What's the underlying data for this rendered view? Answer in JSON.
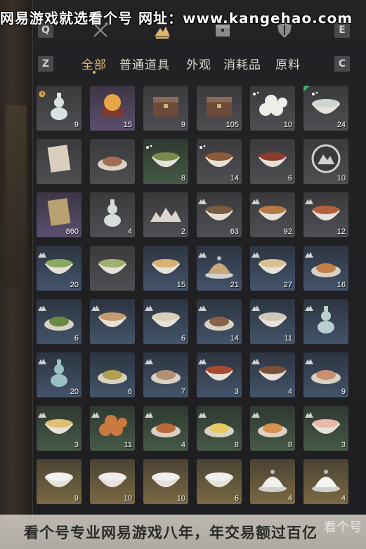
{
  "watermark": {
    "top": "网易游戏就选看个号  网址：www.kangehao.com",
    "bottom": "看个号专业网易游戏八年，年交易额过百亿",
    "logo": "看个号"
  },
  "keys": {
    "q": "Q",
    "e": "E",
    "z": "Z",
    "c": "C"
  },
  "categories": [
    {
      "name": "swords-icon"
    },
    {
      "name": "mountain-icon",
      "active": true
    },
    {
      "name": "chest-icon"
    },
    {
      "name": "shield-icon"
    }
  ],
  "tabs": [
    {
      "label": "全部",
      "active": true
    },
    {
      "label": "普通道具"
    },
    {
      "label": "外观"
    },
    {
      "label": "消耗品"
    },
    {
      "label": "原料"
    }
  ],
  "colors": {
    "accent": "#e0b56a",
    "qty": "#ffffff"
  },
  "items": [
    {
      "icon": "gourd-vase",
      "qty": "9",
      "rarity": "gray",
      "badge": "clock"
    },
    {
      "icon": "golden-orb",
      "qty": "15",
      "rarity": "purple"
    },
    {
      "icon": "wooden-chest",
      "qty": "9",
      "rarity": "gray"
    },
    {
      "icon": "wooden-chest",
      "qty": "105",
      "rarity": "gray"
    },
    {
      "icon": "steamed-buns",
      "qty": "10",
      "rarity": "gray",
      "badge": "sparkle"
    },
    {
      "icon": "porridge-bowl",
      "qty": "24",
      "rarity": "gray",
      "badge": "tag-sparkle"
    },
    {
      "icon": "letter-scroll",
      "qty": "",
      "rarity": "gray"
    },
    {
      "icon": "meat-slice",
      "qty": "",
      "rarity": "gray"
    },
    {
      "icon": "veggie-dish",
      "qty": "8",
      "rarity": "green",
      "badge": "sparkle"
    },
    {
      "icon": "stew-pot",
      "qty": "14",
      "rarity": "gray",
      "badge": "sparkle"
    },
    {
      "icon": "red-stew",
      "qty": "6",
      "rarity": "gray"
    },
    {
      "icon": "mountain-token",
      "qty": "10",
      "rarity": "gray"
    },
    {
      "icon": "talisman",
      "qty": "860",
      "rarity": "purple"
    },
    {
      "icon": "flower-vase",
      "qty": "4",
      "rarity": "gray"
    },
    {
      "icon": "snow-mountains",
      "qty": "2",
      "rarity": "gray"
    },
    {
      "icon": "meat-stew",
      "qty": "63",
      "rarity": "gray",
      "badge": "mountain"
    },
    {
      "icon": "fried-dish",
      "qty": "92",
      "rarity": "gray",
      "badge": "mountain"
    },
    {
      "icon": "soup-pot",
      "qty": "12",
      "rarity": "gray",
      "badge": "mountain"
    },
    {
      "icon": "green-soup",
      "qty": "20",
      "rarity": "blue",
      "badge": "mountain"
    },
    {
      "icon": "green-noodle",
      "qty": "",
      "rarity": "gray"
    },
    {
      "icon": "egg-soup",
      "qty": "15",
      "rarity": "blue"
    },
    {
      "icon": "bun-steamer",
      "qty": "21",
      "rarity": "blue",
      "badge": "mountain"
    },
    {
      "icon": "noodle-bowl",
      "qty": "27",
      "rarity": "blue",
      "badge": "mountain"
    },
    {
      "icon": "noodle-plate",
      "qty": "16",
      "rarity": "blue",
      "badge": "mountain"
    },
    {
      "icon": "greens-plate",
      "qty": "6",
      "rarity": "blue",
      "badge": "mountain"
    },
    {
      "icon": "soup-bowl",
      "qty": "",
      "rarity": "blue",
      "badge": "mountain"
    },
    {
      "icon": "tofu-soup",
      "qty": "6",
      "rarity": "blue",
      "badge": "mountain"
    },
    {
      "icon": "meat-plate",
      "qty": "14",
      "rarity": "blue",
      "badge": "mountain"
    },
    {
      "icon": "rice-bowl",
      "qty": "11",
      "rarity": "blue",
      "badge": "mountain"
    },
    {
      "icon": "wine-vase",
      "qty": "",
      "rarity": "blue",
      "badge": "mountain"
    },
    {
      "icon": "blue-vase",
      "qty": "20",
      "rarity": "blue",
      "badge": "mountain"
    },
    {
      "icon": "grain-plate",
      "qty": "6",
      "rarity": "blue"
    },
    {
      "icon": "dumpling-plate",
      "qty": "7",
      "rarity": "blue",
      "badge": "mountain"
    },
    {
      "icon": "chili-bowl",
      "qty": "3",
      "rarity": "blue",
      "badge": "mountain"
    },
    {
      "icon": "clay-pot",
      "qty": "4",
      "rarity": "blue",
      "badge": "mountain"
    },
    {
      "icon": "pork-slices",
      "qty": "9",
      "rarity": "blue",
      "badge": "mountain"
    },
    {
      "icon": "custard-bowl",
      "qty": "3",
      "rarity": "green",
      "badge": "mountain"
    },
    {
      "icon": "meatballs",
      "qty": "11",
      "rarity": "green",
      "badge": "mountain"
    },
    {
      "icon": "fried-bites",
      "qty": "4",
      "rarity": "green",
      "badge": "mountain"
    },
    {
      "icon": "egg-plate",
      "qty": "8",
      "rarity": "green",
      "badge": "mountain"
    },
    {
      "icon": "layer-cake",
      "qty": "8",
      "rarity": "green",
      "badge": "mountain"
    },
    {
      "icon": "peach-bun",
      "qty": "3",
      "rarity": "green",
      "badge": "mountain"
    },
    {
      "icon": "white-bowl",
      "qty": "9",
      "rarity": "gold"
    },
    {
      "icon": "floral-bowl",
      "qty": "10",
      "rarity": "gold"
    },
    {
      "icon": "painted-bowl",
      "qty": "10",
      "rarity": "gold"
    },
    {
      "icon": "rooster-bowl",
      "qty": "6",
      "rarity": "gold"
    },
    {
      "icon": "lidded-bowl",
      "qty": "4",
      "rarity": "gold"
    },
    {
      "icon": "porcelain-lid",
      "qty": "4",
      "rarity": "gold"
    }
  ]
}
